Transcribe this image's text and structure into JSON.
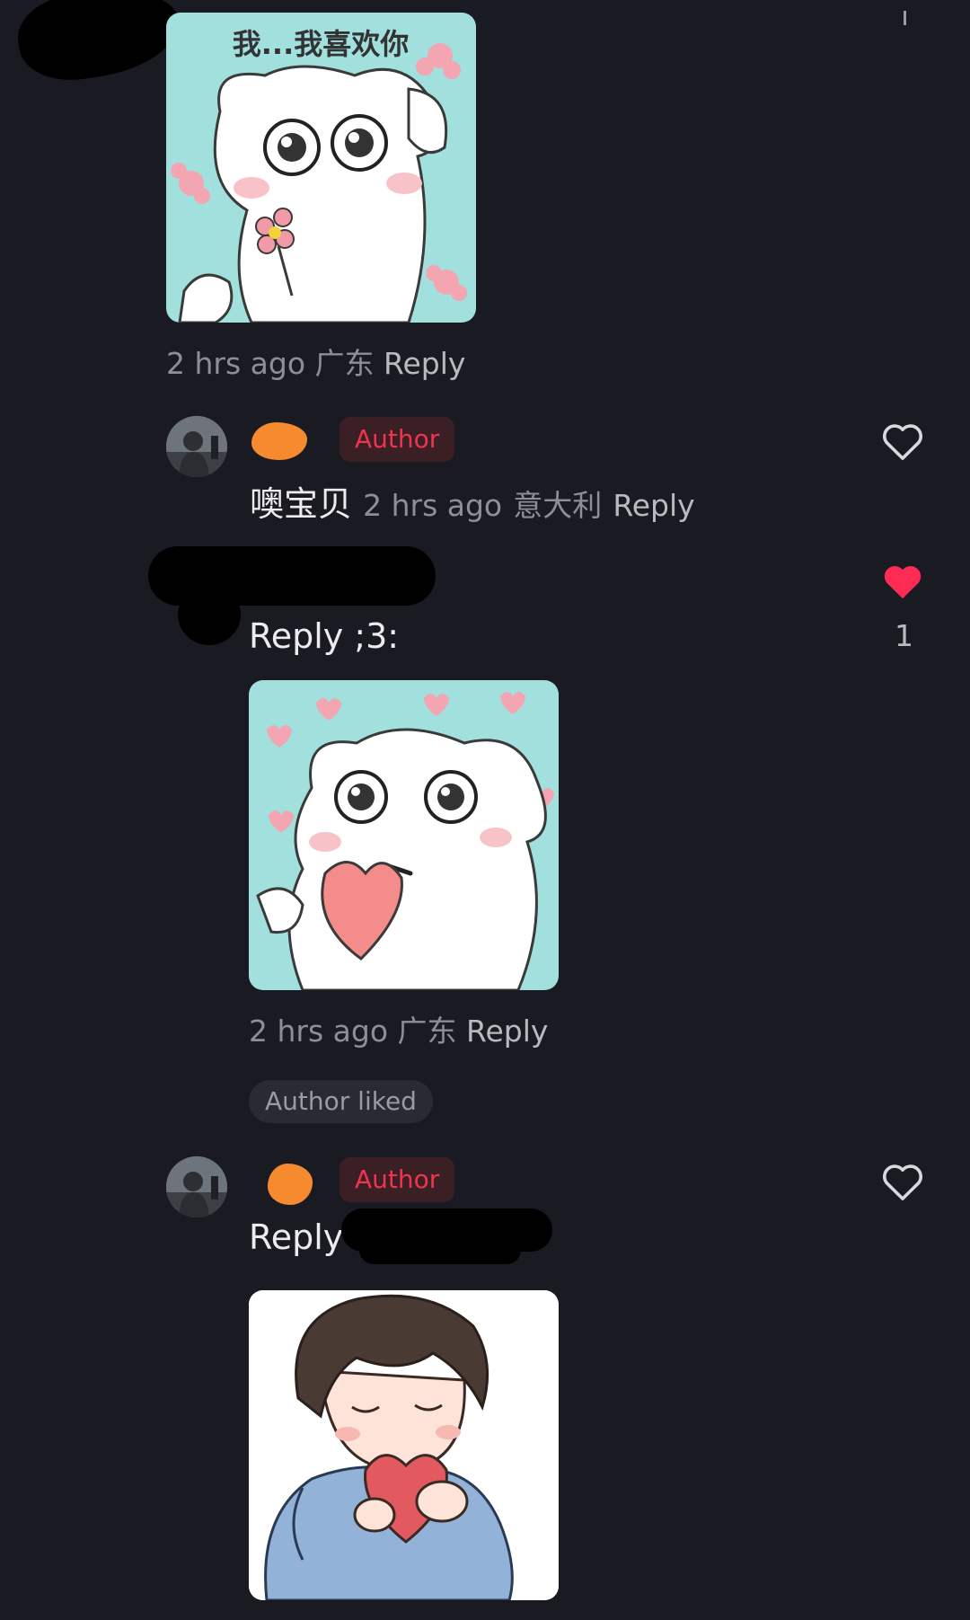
{
  "comments": [
    {
      "sticker_caption": "我...我喜欢你",
      "meta": {
        "time": "2 hrs ago",
        "location": "广东",
        "reply": "Reply"
      }
    },
    {
      "author_badge": "Author",
      "text": "噢宝贝",
      "meta": {
        "time": "2 hrs ago",
        "location": "意大利",
        "reply": "Reply"
      },
      "like_icon": "heart-outline-icon"
    },
    {
      "text": "Reply ;3:",
      "like_icon": "heart-filled-icon",
      "like_count": "1",
      "meta": {
        "time": "2 hrs ago",
        "location": "广东",
        "reply": "Reply"
      },
      "author_liked": "Author liked"
    },
    {
      "author_badge": "Author",
      "text": "Reply",
      "like_icon": "heart-outline-icon"
    }
  ],
  "colors": {
    "background": "#1a1a22",
    "author_badge_text": "#f0344f",
    "like_active": "#fe2c55",
    "muted_text": "#8e8e96"
  }
}
